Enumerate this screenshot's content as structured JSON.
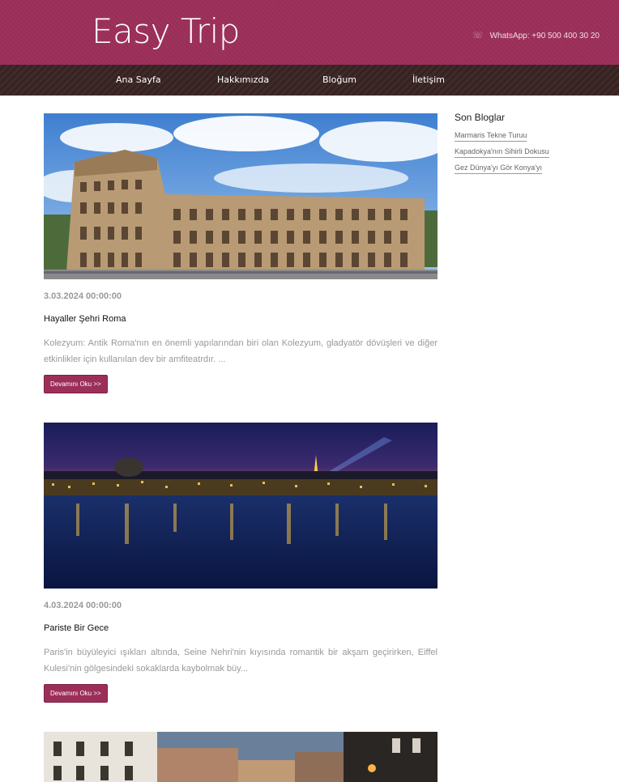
{
  "header": {
    "logo": "Easy Trip",
    "contact": "WhatsApp: +90 500 400 30 20",
    "contact_icon": "phone-icon"
  },
  "nav": {
    "items": [
      {
        "label": "Ana Sayfa"
      },
      {
        "label": "Hakkımızda"
      },
      {
        "label": "Bloğum"
      },
      {
        "label": "İletişim"
      }
    ]
  },
  "posts": [
    {
      "date": "3.03.2024 00:00:00",
      "title": "Hayaller Şehri Roma",
      "excerpt": "Kolezyum: Antik Roma'nın en önemli yapılarından biri olan Kolezyum, gladyatör dövüşleri ve diğer etkinlikler için kullanılan dev bir amfiteatrdır. ...",
      "button": "Devamını Oku >>"
    },
    {
      "date": "4.03.2024 00:00:00",
      "title": "Pariste Bir Gece",
      "excerpt": "Paris'in büyüleyici ışıkları altında, Seine Nehri'nin kıyısında romantik bir akşam geçirirken, Eiffel Kulesi'nin gölgesindeki sokaklarda kaybolmak büy...",
      "button": "Devamını Oku >>"
    }
  ],
  "sidebar": {
    "title": "Son Bloglar",
    "links": [
      {
        "label": "Marmaris Tekne Turuu"
      },
      {
        "label": "Kapadokya'nın Sihirli Dokusu"
      },
      {
        "label": "Gez Dünya'yı Gör Konya'yı"
      }
    ]
  },
  "colors": {
    "brand": "#9c2f59",
    "nav_bg": "#3a2424"
  }
}
